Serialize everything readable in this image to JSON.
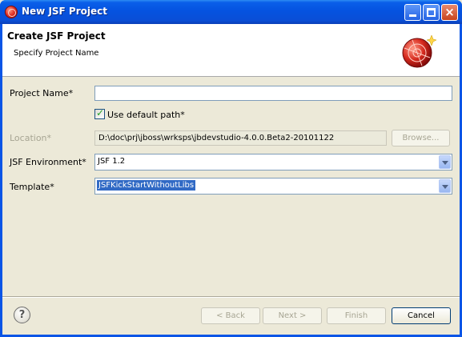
{
  "window": {
    "title": "New JSF Project",
    "icon": "jboss-icon"
  },
  "banner": {
    "title": "Create JSF Project",
    "subtitle": "Specify Project Name",
    "logo": "jsf-project-wizard-icon"
  },
  "form": {
    "project_name": {
      "label": "Project Name*",
      "value": ""
    },
    "use_default_path": {
      "label": "Use default path*",
      "checked": true
    },
    "location": {
      "label": "Location*",
      "value": "D:\\doc\\prj\\jboss\\wrksps\\jbdevstudio-4.0.0.Beta2-20101122",
      "browse_label": "Browse..."
    },
    "jsf_environment": {
      "label": "JSF Environment*",
      "value": "JSF 1.2"
    },
    "template": {
      "label": "Template*",
      "value": "JSFKickStartWithoutLibs"
    }
  },
  "footer": {
    "help_symbol": "?",
    "back_label": "< Back",
    "next_label": "Next >",
    "finish_label": "Finish",
    "cancel_label": "Cancel"
  }
}
